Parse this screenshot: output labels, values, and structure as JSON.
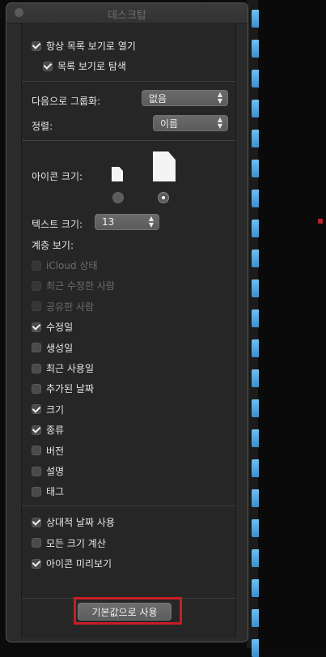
{
  "window": {
    "title": "데스크탑"
  },
  "options": {
    "open_in_list_view": {
      "label": "항상 목록 보기로 열기",
      "checked": true
    },
    "browse_in_list_view": {
      "label": "목록 보기로 탐색",
      "checked": true
    }
  },
  "group_by": {
    "label": "다음으로 그룹화:",
    "value": "없음"
  },
  "sort_by": {
    "label": "정렬:",
    "value": "이름"
  },
  "icon_size": {
    "label": "아이콘 크기:",
    "selected": "large"
  },
  "text_size": {
    "label": "텍스트 크기:",
    "value": "13"
  },
  "columns": {
    "label": "계층 보기:",
    "items": [
      {
        "label": "iCloud 상태",
        "checked": false,
        "disabled": true
      },
      {
        "label": "최근 수정한 사람",
        "checked": false,
        "disabled": true
      },
      {
        "label": "공유한 사람",
        "checked": false,
        "disabled": true
      },
      {
        "label": "수정일",
        "checked": true,
        "disabled": false
      },
      {
        "label": "생성일",
        "checked": false,
        "disabled": false
      },
      {
        "label": "최근 사용일",
        "checked": false,
        "disabled": false
      },
      {
        "label": "추가된 날짜",
        "checked": false,
        "disabled": false
      },
      {
        "label": "크기",
        "checked": true,
        "disabled": false
      },
      {
        "label": "종류",
        "checked": true,
        "disabled": false
      },
      {
        "label": "버전",
        "checked": false,
        "disabled": false
      },
      {
        "label": "설명",
        "checked": false,
        "disabled": false
      },
      {
        "label": "태그",
        "checked": false,
        "disabled": false
      }
    ]
  },
  "extra_options": [
    {
      "label": "상대적 날짜 사용",
      "checked": true
    },
    {
      "label": "모든 크기 계산",
      "checked": false
    },
    {
      "label": "아이콘 미리보기",
      "checked": true
    }
  ],
  "footer": {
    "use_defaults_label": "기본값으로 사용"
  }
}
